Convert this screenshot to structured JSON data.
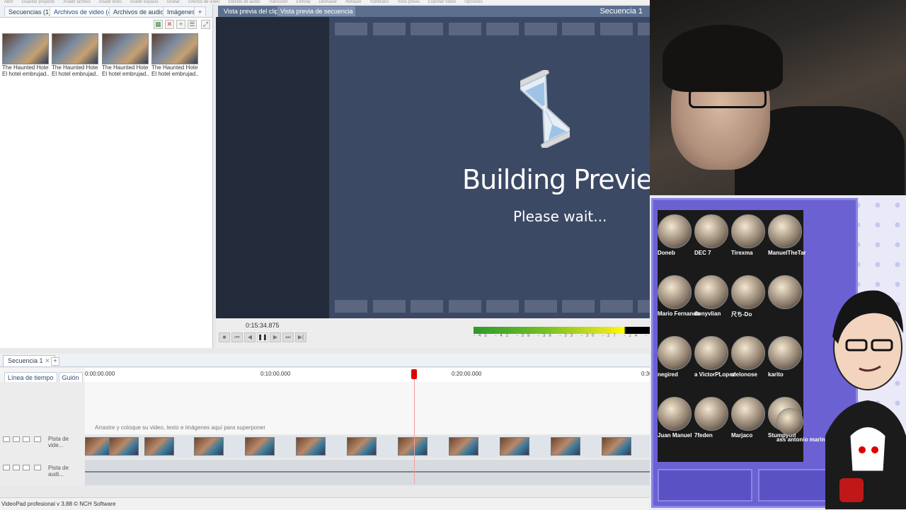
{
  "app": {
    "status_text": "VideoPad profesional v 3.88 © NCH Software",
    "top_menu": [
      "Abrir",
      "Guardar proyecto",
      "Añadir archivo",
      "Añadir texto",
      "Añadir espacio",
      "Grabar",
      "Efectos de video",
      "Efectos de audio",
      "Transición",
      "Elimina",
      "Deshacer",
      "Rehacer",
      "Subtítulos",
      "Vista previa",
      "Exportar Video",
      "Opciones"
    ]
  },
  "media_tabs": [
    {
      "label": "Secuencias (1)"
    },
    {
      "label": "Archivos de video (4)"
    },
    {
      "label": "Archivos de audio"
    },
    {
      "label": "Imágenes"
    },
    {
      "label": "+"
    }
  ],
  "media_items": [
    {
      "line1": "The Haunted Hotel -",
      "line2": "El hotel embrujad..."
    },
    {
      "line1": "The Haunted Hotel -",
      "line2": "El hotel embrujad..."
    },
    {
      "line1": "The Haunted Hotel -",
      "line2": "El hotel embrujad..."
    },
    {
      "line1": "The Haunted Hotel -",
      "line2": "El hotel embrujad..."
    }
  ],
  "preview": {
    "tab_clip": "Vista previa del clip",
    "tab_sequence": "Vista previa de secuencia",
    "sequence_name": "Secuencia 1",
    "building_title": "Building Preview",
    "building_sub": "Please wait...",
    "timecode": "0:15:34.875",
    "meter_scale": "-45 -42 -39 -36 -33 -30 -27 -24 -21 -18 -15 -12 -9"
  },
  "sequence": {
    "tab_label": "Secuencia 1",
    "plus_label": "+",
    "mode_timeline": "Línea de tiempo",
    "mode_storyboard": "Guión",
    "ruler": [
      "0:00:00.000",
      "0:10:00.000",
      "0:20:00.000",
      "0:30"
    ],
    "overlay_hint": "Arrastre y coloque su video, texto e imágenes aquí para superponer",
    "video_track": "Pista de vide...",
    "audio_track": "Pista de audi..."
  },
  "supporters": [
    {
      "name": "Doneb"
    },
    {
      "name": "DEC 7"
    },
    {
      "name": "Tirexma"
    },
    {
      "name": "ManuelTheTar"
    },
    {
      "name": "Mario Fernando"
    },
    {
      "name": "donyvlian"
    },
    {
      "name": "尺ち-Do"
    },
    {
      "name": ""
    },
    {
      "name": "negired"
    },
    {
      "name": "a VictorPLopez"
    },
    {
      "name": "alelonose"
    },
    {
      "name": "karito"
    },
    {
      "name": "Juan Manuel"
    },
    {
      "name": "7feden"
    },
    {
      "name": "Marjaco"
    },
    {
      "name": "Stumpyoff"
    },
    {
      "name": "ass antonio marin"
    }
  ],
  "colors": {
    "preview_bg": "#3c4964",
    "playhead": "#e00000",
    "overlay_frame": "#6c61d3"
  }
}
